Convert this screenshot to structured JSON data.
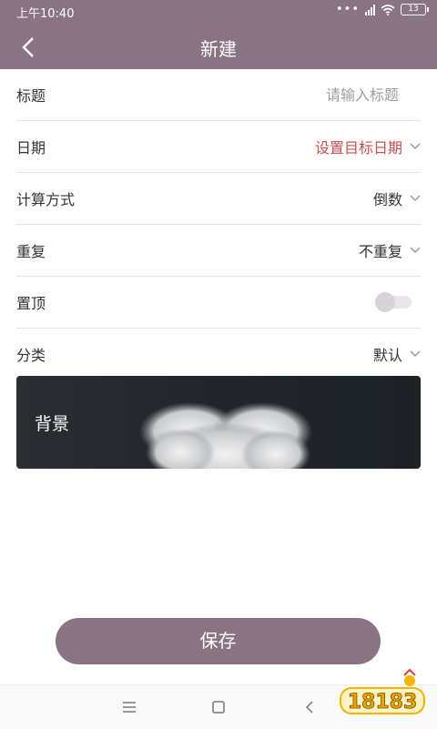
{
  "status": {
    "time": "上午10:40",
    "hd": "HD",
    "battery": "13"
  },
  "header": {
    "title": "新建"
  },
  "form": {
    "title_label": "标题",
    "title_placeholder": "请输入标题",
    "date_label": "日期",
    "date_value": "设置目标日期",
    "calc_label": "计算方式",
    "calc_value": "倒数",
    "repeat_label": "重复",
    "repeat_value": "不重复",
    "pin_label": "置顶",
    "pin_on": false,
    "category_label": "分类",
    "category_value": "默认"
  },
  "background": {
    "label": "背景"
  },
  "save_label": "保存",
  "watermark": "18183",
  "colors": {
    "header": "#8a7483",
    "accent_red": "#c55050"
  },
  "icons": [
    "back-icon",
    "chevron-down-icon",
    "menu-icon",
    "home-icon",
    "nav-back-icon"
  ]
}
